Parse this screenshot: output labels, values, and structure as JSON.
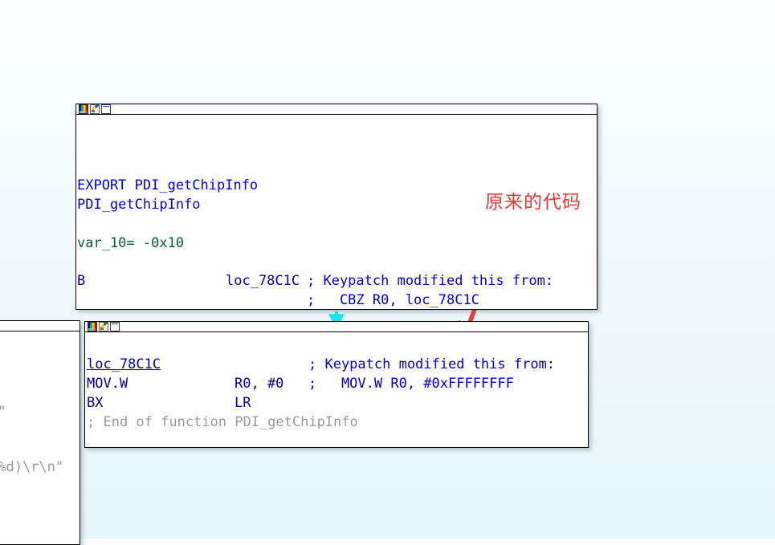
{
  "background": {
    "gradient_top": "#fbfeff",
    "gradient_bottom": "#e6f6fb"
  },
  "annotations": {
    "chinese_note": "原来的代码",
    "note_color": "#f0353a",
    "arrow_color": "#ee3b36",
    "cyan_arrow_color": "#18e8f0"
  },
  "left_panel": {
    "name": "partial-disassembly-panel",
    "lines": [
      {
        "text": "c\"",
        "color": "#9a9a9a"
      },
      {
        "text": "|%d)\\r\\n\"",
        "color": "#9a9a9a"
      }
    ]
  },
  "top_window": {
    "name": "ida-graph-window-top",
    "title": "",
    "icons": [
      "palette-icon",
      "pencil-icon",
      "face-icon"
    ],
    "lines": [
      {
        "text": "EXPORT PDI_getChipInfo",
        "color": "#0000d8"
      },
      {
        "text": "PDI_getChipInfo",
        "color": "#0000d8"
      },
      {
        "text": "var_10= -0x10",
        "color": "#006030"
      }
    ],
    "instruction": {
      "mnemonic": "B",
      "operand": "loc_78C1C",
      "comment": "; Keypatch modified this from:",
      "comment2": ";   CBZ R0, loc_78C1C"
    }
  },
  "bottom_window": {
    "name": "ida-graph-window-bottom",
    "title": "",
    "icons": [
      "palette-icon",
      "pencil-icon",
      "face-icon"
    ],
    "rows": [
      {
        "label": "loc_78C1C",
        "operand": "",
        "comment": "; Keypatch modified this from:"
      },
      {
        "label": "MOV.W",
        "operand": "R0, #0",
        "comment": ";   MOV.W R0, #0xFFFFFFFF"
      },
      {
        "label": "BX",
        "operand": "LR",
        "comment": ""
      }
    ],
    "end_comment": "; End of function PDI_getChipInfo"
  }
}
